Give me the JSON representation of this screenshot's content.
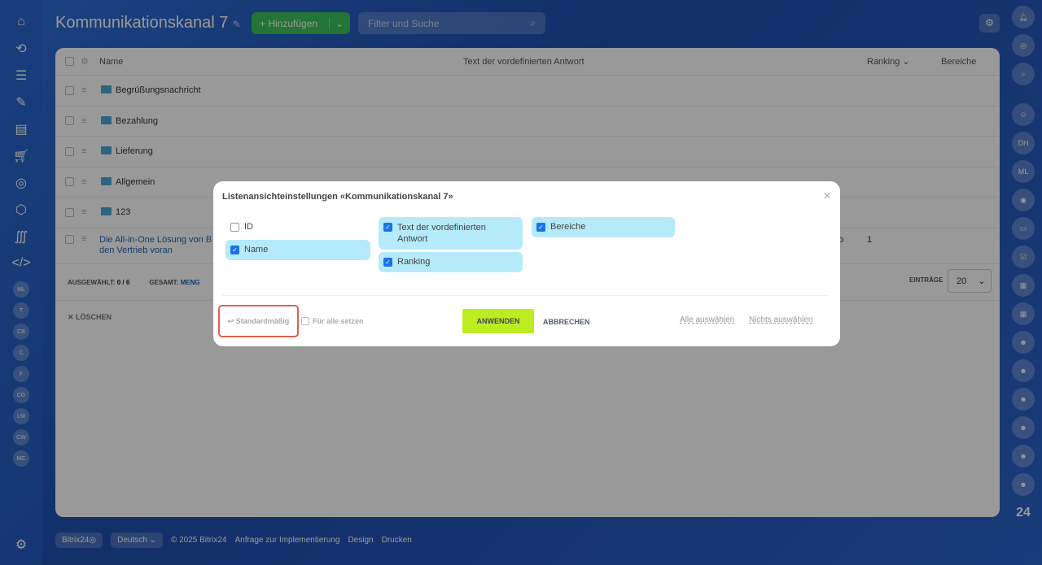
{
  "header": {
    "title": "Kommunikationskanal 7",
    "add_label": "Hinzufügen",
    "search_placeholder": "Filter und Suche"
  },
  "left_sidebar": {
    "avatars": [
      "ML",
      "T",
      "CB",
      "C",
      "F",
      "CG",
      "LM",
      "CW",
      "MC"
    ]
  },
  "right_sidebar": {
    "avatars": [
      "DH",
      "ML"
    ]
  },
  "table": {
    "columns": [
      "Name",
      "Text der vordefinierten Antwort",
      "Ranking",
      "Bereiche"
    ],
    "folders": [
      "Begrüßungsnachricht",
      "Bezahlung",
      "Lieferung",
      "Allgemein",
      "123"
    ],
    "item": {
      "name_line1": "Die All-in-One Lösung von B",
      "name_line2": "den Vertrieb voran",
      "ranking_partial": "o",
      "bereiche": "1"
    },
    "selected_label": "AUSGEWÄHLT:",
    "selected_value": "0 / 6",
    "total_label": "GESAMT:",
    "total_value": "MENG",
    "entries_label": "EINTRÄGE",
    "entries_value": "20",
    "delete_label": "LÖSCHEN"
  },
  "footer": {
    "brand": "Bitrix24",
    "language": "Deutsch",
    "copyright": "© 2025 Bitrix24",
    "links": [
      "Anfrage zur Implementierung",
      "Design",
      "Drucken"
    ]
  },
  "modal": {
    "title": "Listenansichteinstellungen «Kommunikationskanal 7»",
    "options": [
      {
        "label": "ID",
        "checked": false
      },
      {
        "label": "Name",
        "checked": true
      },
      {
        "label": "Text der vordefinierten Antwort",
        "checked": true
      },
      {
        "label": "Ranking",
        "checked": true
      },
      {
        "label": "Bereiche",
        "checked": true
      }
    ],
    "default_label": "Standardmäßig",
    "for_all_label": "Für alle setzen",
    "apply_label": "ANWENDEN",
    "cancel_label": "ABBRECHEN",
    "select_all_label": "Alle auswählen",
    "select_none_label": "Nichts auswählen"
  }
}
